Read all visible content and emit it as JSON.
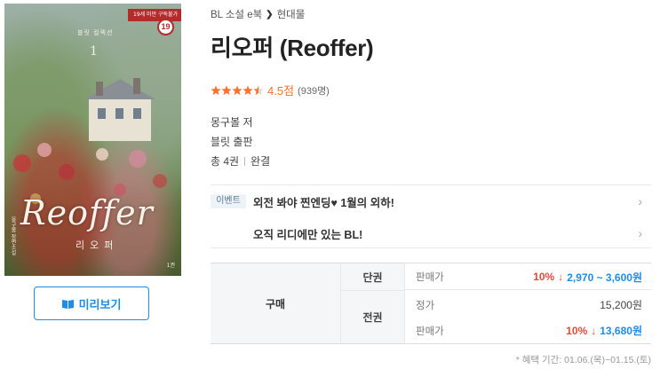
{
  "cover": {
    "band_text": "19세 미만 구독불가",
    "age_badge": "19",
    "series_text": "블릿 컬렉션",
    "volume": "1",
    "title_art": "Reoffer",
    "subtitle_art": "리오퍼",
    "side_text": "몽구볼 장편소설",
    "corner_text": "1권"
  },
  "preview_button": {
    "icon": "book-open-icon",
    "label": "미리보기"
  },
  "breadcrumb": {
    "category": "BL 소설 e북",
    "subcategory": "현대물",
    "separator_icon": "chevron-right-icon"
  },
  "book": {
    "title": "리오퍼 (Reoffer)"
  },
  "rating": {
    "stars": 4.5,
    "score": "4.5점",
    "count": "(939명)",
    "color": "#fa722e"
  },
  "meta": {
    "author": "몽구볼 저",
    "publisher": "블릿 출판",
    "volumes": "총 4권",
    "status": "완결"
  },
  "events": [
    {
      "tag": "이벤트",
      "text": "외전 봐야 찐엔딩♥ 1월의 외하!"
    },
    {
      "tag": "",
      "text": "오직 리디에만 있는 BL!"
    }
  ],
  "purchase": {
    "header": "구매",
    "single": {
      "label": "단권",
      "sale_label": "판매가",
      "discount": "10%",
      "arrow": "↓",
      "price": "2,970 ~ 3,600원"
    },
    "full": {
      "label": "전권",
      "regular_label": "정가",
      "regular_price": "15,200원",
      "sale_label": "판매가",
      "discount": "10%",
      "arrow": "↓",
      "price": "13,680원"
    }
  },
  "benefit_note": "* 혜택 기간: 01.06.(목)~01.15.(토)",
  "colors": {
    "accent": "#1f8ce6",
    "discount": "#e64938",
    "star": "#fa722e"
  }
}
